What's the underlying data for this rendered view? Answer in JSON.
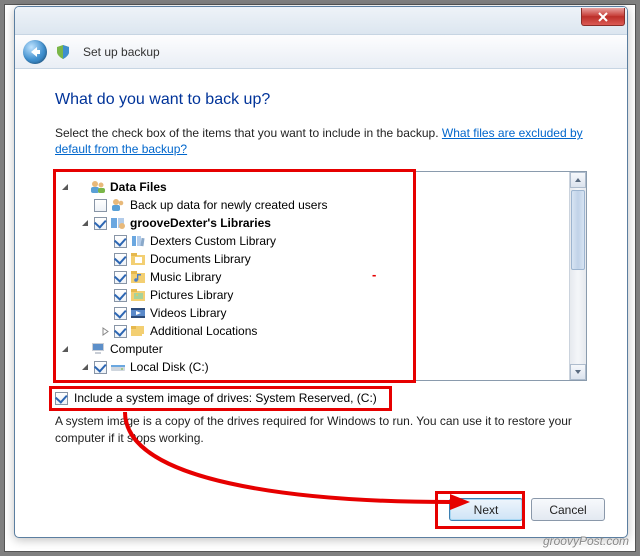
{
  "window": {
    "title": "Set up backup",
    "close_label": "Close"
  },
  "page": {
    "heading": "What do you want to back up?",
    "instruction": "Select the check box of the items that you want to include in the backup. ",
    "link_text": "What files are excluded by default from the backup?"
  },
  "tree": {
    "data_files": "Data Files",
    "newly_created": "Back up data for newly created users",
    "user_libraries": "grooveDexter's Libraries",
    "custom_library": "Dexters Custom Library",
    "documents": "Documents Library",
    "music": "Music Library",
    "pictures": "Pictures Library",
    "videos": "Videos Library",
    "additional": "Additional Locations",
    "computer": "Computer",
    "local_disk": "Local Disk (C:)"
  },
  "system_image": {
    "label": "Include a system image of drives: System Reserved, (C:)",
    "description": "A system image is a copy of the drives required for Windows to run. You can use it to restore your computer if it stops working."
  },
  "buttons": {
    "next": "Next",
    "cancel": "Cancel"
  },
  "watermark": "groovyPost.com"
}
